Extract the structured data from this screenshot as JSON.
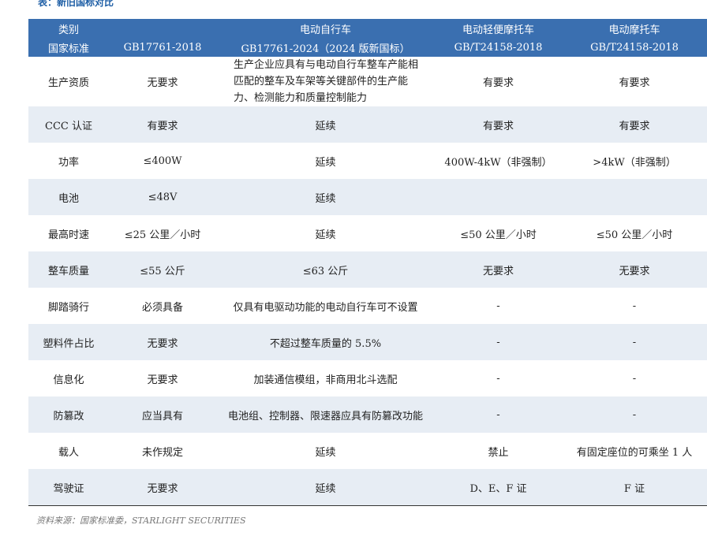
{
  "caption": "表：新旧国标对比",
  "header": {
    "row1": [
      "类别",
      "",
      "电动自行车",
      "电动轻便摩托车",
      "电动摩托车"
    ],
    "row2": [
      "国家标准",
      "GB17761-2018",
      "GB17761-2024（2024 版新国标）",
      "GB/T24158-2018",
      "GB/T24158-2018"
    ]
  },
  "rows": [
    {
      "label": "生产资质",
      "old": "无要求",
      "new": "生产企业应具有与电动自行车整车产能相匹配的整车及车架等关键部件的生产能力、检测能力和质量控制能力",
      "light_moto": "有要求",
      "moto": "有要求"
    },
    {
      "label": "CCC 认证",
      "old": "有要求",
      "new": "延续",
      "light_moto": "有要求",
      "moto": "有要求"
    },
    {
      "label": "功率",
      "old": "≤400W",
      "new": "延续",
      "light_moto": "400W-4kW（非强制）",
      "moto": ">4kW（非强制）"
    },
    {
      "label": "电池",
      "old": "≤48V",
      "new": "延续",
      "light_moto": "",
      "moto": ""
    },
    {
      "label": "最高时速",
      "old": "≤25 公里／小时",
      "new": "延续",
      "light_moto": "≤50 公里／小时",
      "moto": "≤50 公里／小时"
    },
    {
      "label": "整车质量",
      "old": "≤55 公斤",
      "new": "≤63 公斤",
      "light_moto": "无要求",
      "moto": "无要求"
    },
    {
      "label": "脚踏骑行",
      "old": "必须具备",
      "new": "仅具有电驱动功能的电动自行车可不设置",
      "light_moto": "-",
      "moto": "-"
    },
    {
      "label": "塑料件占比",
      "old": "无要求",
      "new": "不超过整车质量的 5.5%",
      "light_moto": "-",
      "moto": "-"
    },
    {
      "label": "信息化",
      "old": "无要求",
      "new": "加装通信模组，非商用北斗选配",
      "light_moto": "-",
      "moto": "-"
    },
    {
      "label": "防篡改",
      "old": "应当具有",
      "new": "电池组、控制器、限速器应具有防篡改功能",
      "light_moto": "-",
      "moto": "-"
    },
    {
      "label": "载人",
      "old": "未作规定",
      "new": "延续",
      "light_moto": "禁止",
      "moto": "有固定座位的可乘坐 1 人"
    },
    {
      "label": "驾驶证",
      "old": "无要求",
      "new": "延续",
      "light_moto": "D、E、F 证",
      "moto": "F 证"
    }
  ],
  "source": "资料来源：国家标准委，STARLIGHT SECURITIES",
  "colors": {
    "header_bg": "#3a6fb0",
    "stripe_bg": "#e7edf4",
    "caption": "#1f5fa6"
  }
}
